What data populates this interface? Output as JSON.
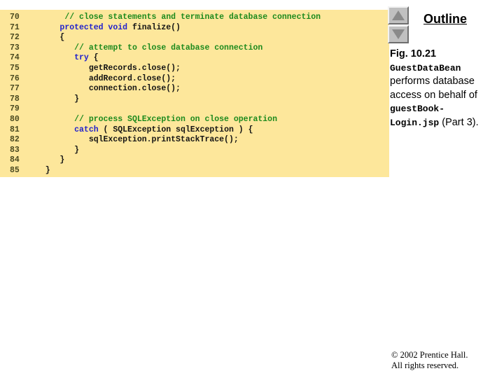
{
  "scroll_controls": {
    "up_label": "scroll up",
    "down_label": "scroll down"
  },
  "outline": {
    "title": "Outline",
    "figure": {
      "label": "Fig. 10.21",
      "class_name": "GuestDataBean",
      "text_1": "performs database",
      "text_2": "access on behalf of",
      "file_name_1": "guestBook-",
      "file_name_2": "Login.jsp",
      "part": " (Part 3)."
    }
  },
  "footer": {
    "line1": "© 2002 Prentice Hall.",
    "line2": "All rights reserved."
  },
  "code": {
    "language": "java",
    "lines": [
      {
        "number": "70",
        "segments": [
          {
            "t": "       ",
            "c": "pln"
          },
          {
            "t": "// close statements and terminate database connection",
            "c": "cmt"
          }
        ]
      },
      {
        "number": "71",
        "segments": [
          {
            "t": "      ",
            "c": "pln"
          },
          {
            "t": "protected void",
            "c": "kw"
          },
          {
            "t": " finalize()",
            "c": "pln"
          }
        ]
      },
      {
        "number": "72",
        "segments": [
          {
            "t": "      {",
            "c": "pln"
          }
        ]
      },
      {
        "number": "73",
        "segments": [
          {
            "t": "         ",
            "c": "pln"
          },
          {
            "t": "// attempt to close database connection",
            "c": "cmt"
          }
        ]
      },
      {
        "number": "74",
        "segments": [
          {
            "t": "         ",
            "c": "pln"
          },
          {
            "t": "try",
            "c": "kw"
          },
          {
            "t": " {",
            "c": "pln"
          }
        ]
      },
      {
        "number": "75",
        "segments": [
          {
            "t": "            getRecords.close();",
            "c": "pln"
          }
        ]
      },
      {
        "number": "76",
        "segments": [
          {
            "t": "            addRecord.close();",
            "c": "pln"
          }
        ]
      },
      {
        "number": "77",
        "segments": [
          {
            "t": "            connection.close();",
            "c": "pln"
          }
        ]
      },
      {
        "number": "78",
        "segments": [
          {
            "t": "         }",
            "c": "pln"
          }
        ]
      },
      {
        "number": "79",
        "segments": [
          {
            "t": "",
            "c": "pln"
          }
        ]
      },
      {
        "number": "80",
        "segments": [
          {
            "t": "         ",
            "c": "pln"
          },
          {
            "t": "// process SQLException on close operation",
            "c": "cmt"
          }
        ]
      },
      {
        "number": "81",
        "segments": [
          {
            "t": "         ",
            "c": "pln"
          },
          {
            "t": "catch",
            "c": "kw"
          },
          {
            "t": " ( SQLException sqlException ) {",
            "c": "pln"
          }
        ]
      },
      {
        "number": "82",
        "segments": [
          {
            "t": "            sqlException.printStackTrace();",
            "c": "pln"
          }
        ]
      },
      {
        "number": "83",
        "segments": [
          {
            "t": "         }",
            "c": "pln"
          }
        ]
      },
      {
        "number": "84",
        "segments": [
          {
            "t": "      }",
            "c": "pln"
          }
        ]
      },
      {
        "number": "85",
        "segments": [
          {
            "t": "   }",
            "c": "pln"
          }
        ]
      }
    ]
  }
}
